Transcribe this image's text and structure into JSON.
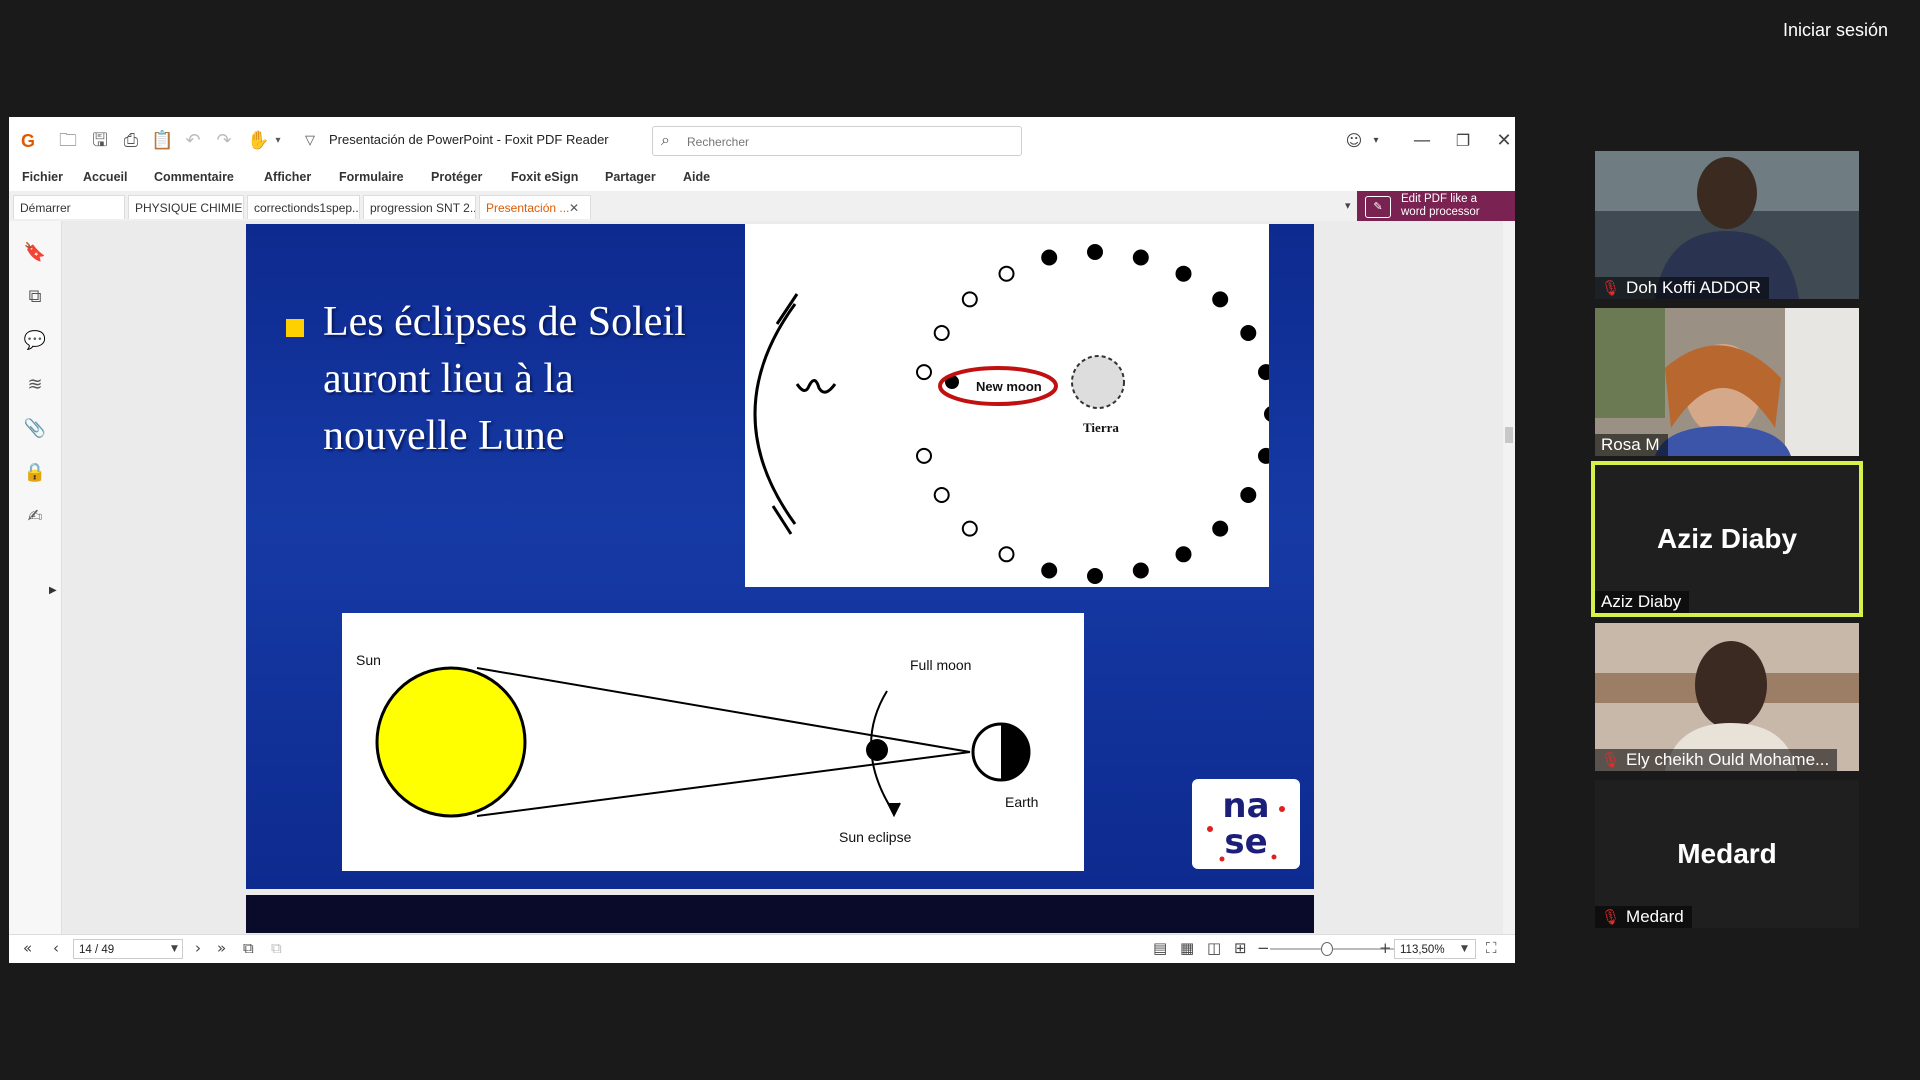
{
  "meeting": {
    "signin_label": "Iniciar sesión"
  },
  "window": {
    "title": "Presentación de PowerPoint - Foxit PDF Reader",
    "search_placeholder": "Rechercher"
  },
  "menu": [
    "Fichier",
    "Accueil",
    "Commentaire",
    "Afficher",
    "Formulaire",
    "Protéger",
    "Foxit eSign",
    "Partager",
    "Aide"
  ],
  "tabs": [
    {
      "label": "Démarrer"
    },
    {
      "label": "PHYSIQUE CHIMIE..."
    },
    {
      "label": "correctionds1spep..."
    },
    {
      "label": "progression SNT 2..."
    },
    {
      "label": "Presentación ..."
    }
  ],
  "edit_pdf": {
    "line1": "Edit PDF like a",
    "line2": "word processor"
  },
  "slide": {
    "text": "Les éclipses de Soleil auront lieu à la nouvelle Lune",
    "top_figure": {
      "new_moon": "New moon",
      "earth": "Tierra"
    },
    "bottom_figure": {
      "sun": "Sun",
      "full_moon": "Full moon",
      "earth": "Earth",
      "sun_eclipse": "Sun eclipse"
    },
    "logo": {
      "line1": "na",
      "line2": "se"
    }
  },
  "status": {
    "page": "14 / 49",
    "zoom": "113,50%"
  },
  "participants": [
    {
      "name": "Doh Koffi ADDOR",
      "muted": true,
      "video": true,
      "bg": "#5b6a70"
    },
    {
      "name": "Rosa M",
      "muted": false,
      "video": true,
      "bg": "#8c8478"
    },
    {
      "name": "Aziz Diaby",
      "muted": false,
      "video": false,
      "active": true,
      "big_name": "Aziz Diaby"
    },
    {
      "name": "Ely cheikh Ould Mohame...",
      "muted": true,
      "video": true,
      "bg": "#b9a89a"
    },
    {
      "name": "Medard",
      "muted": true,
      "video": false,
      "big_name": "Medard"
    }
  ],
  "colors": {
    "accent": "#e05a00",
    "edit_pdf_bg": "#7a2252",
    "active_speaker": "#d7f04a",
    "slide_blue": "#0d2a8f",
    "sun": "#ffff00"
  }
}
